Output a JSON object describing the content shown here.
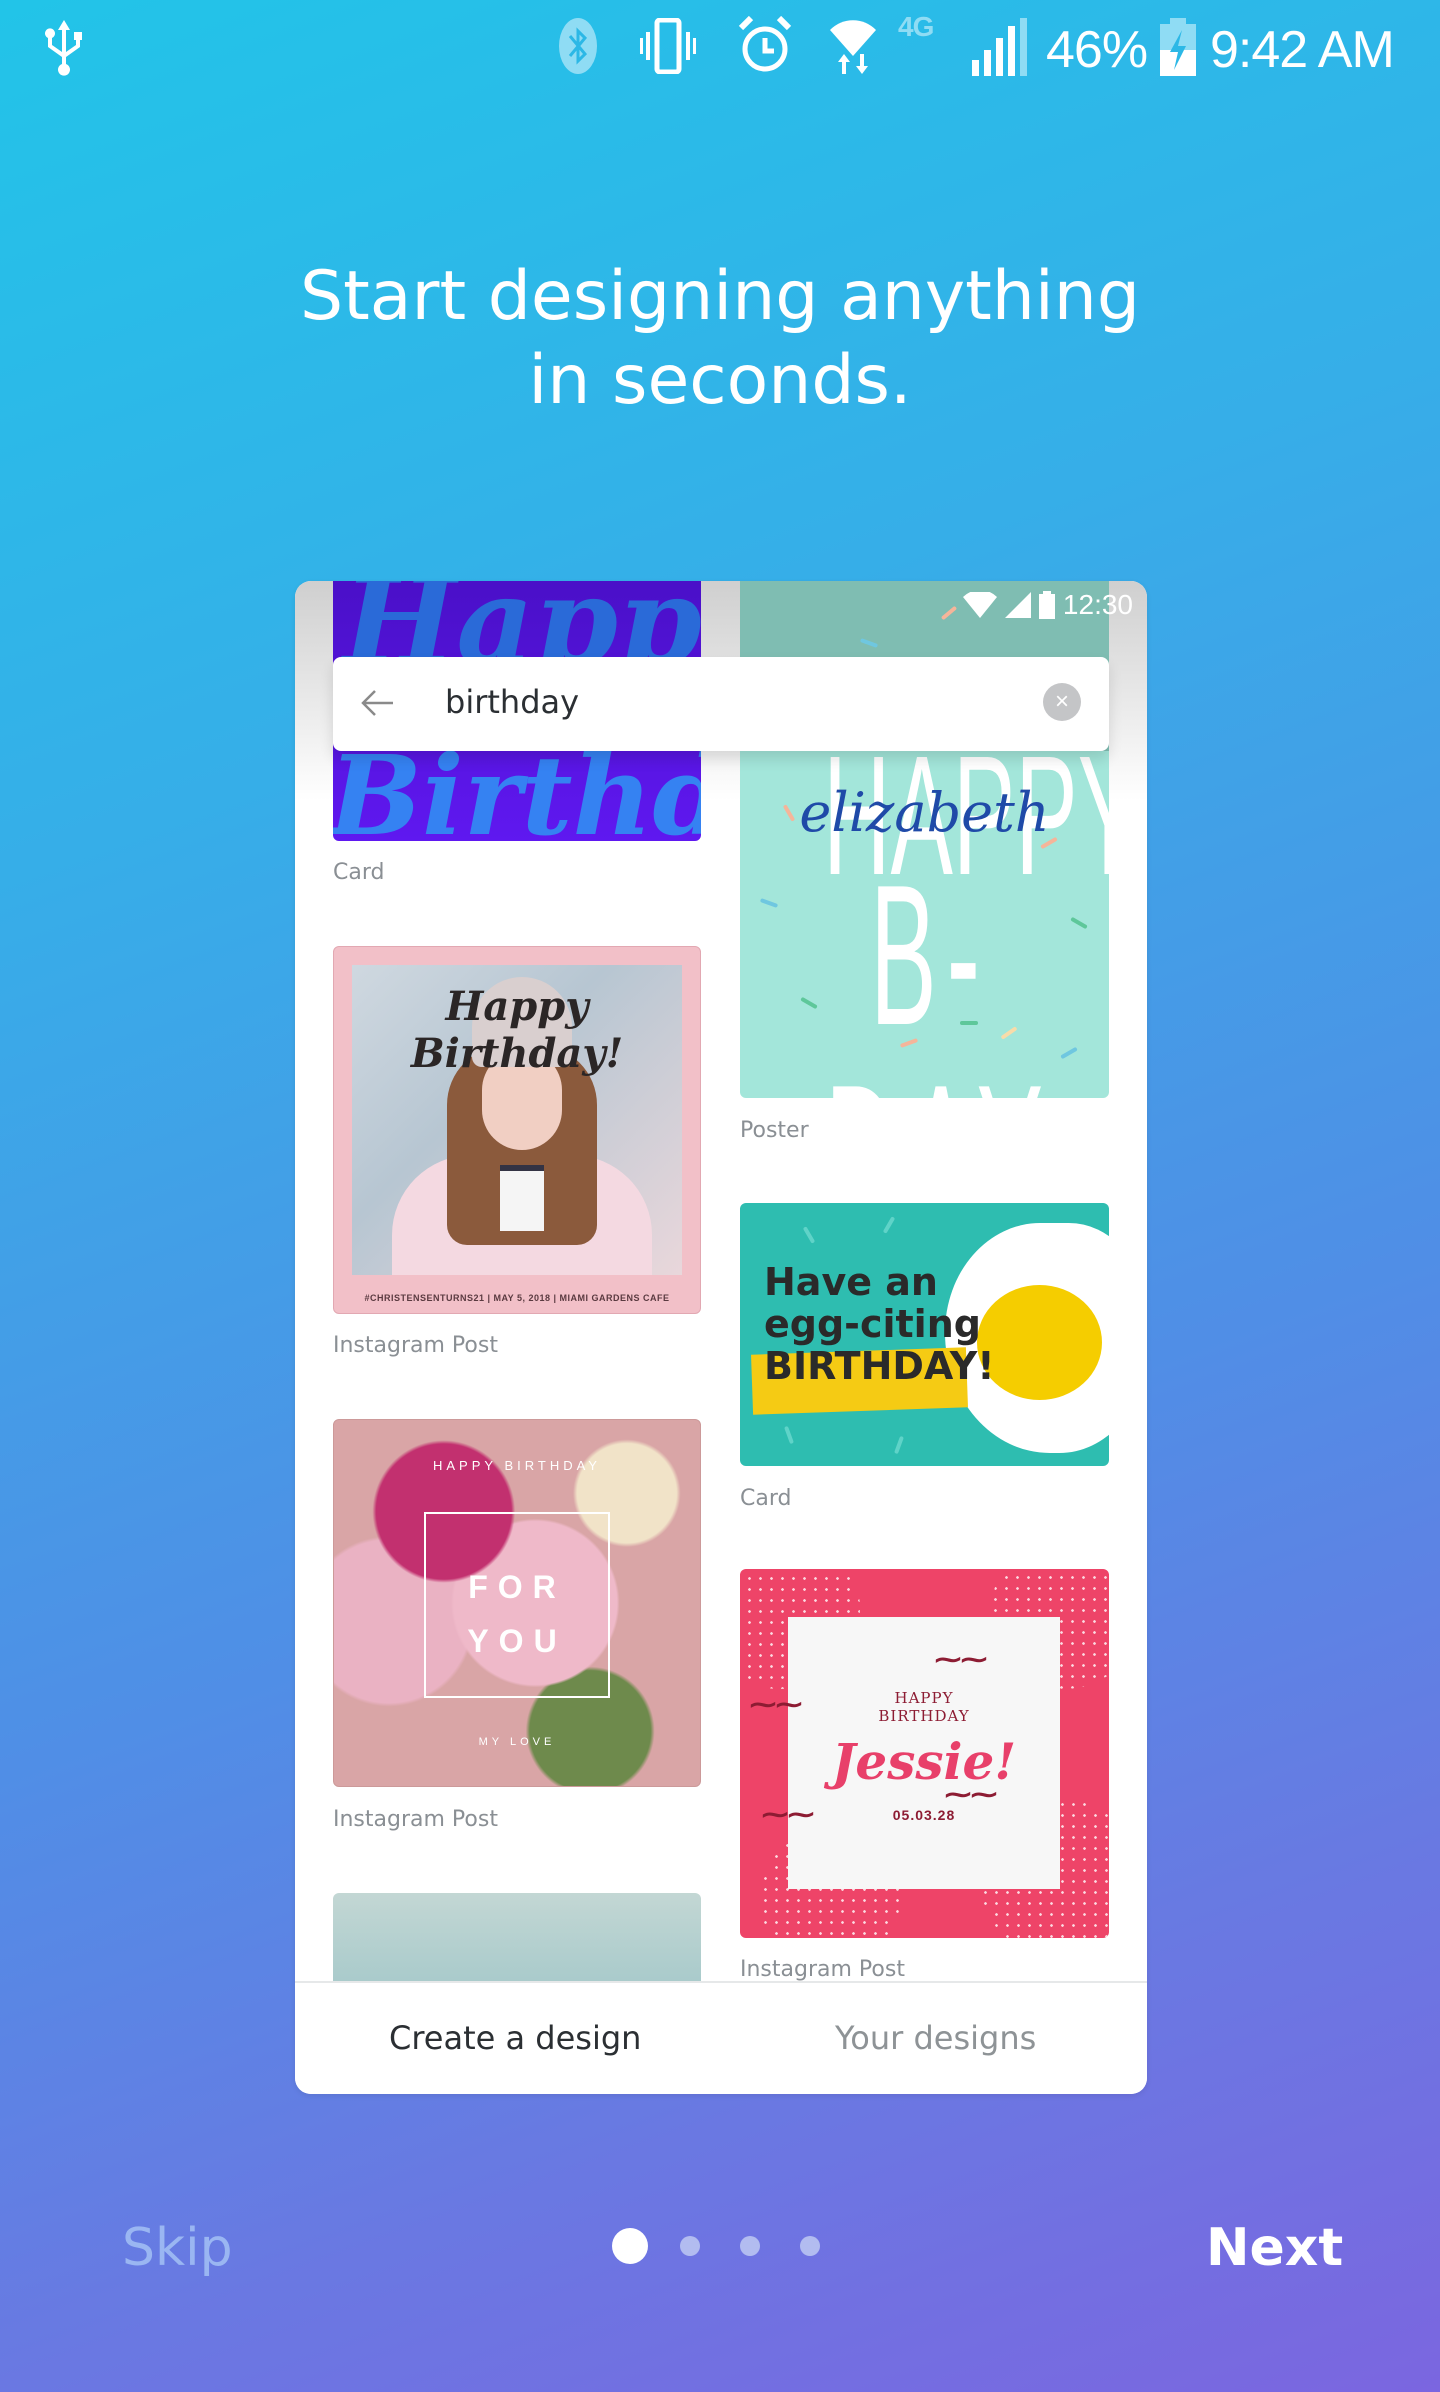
{
  "status_bar": {
    "left_icons": [
      "usb-icon"
    ],
    "right_icons": [
      "bluetooth-icon",
      "vibrate-icon",
      "alarm-icon",
      "wifi-icon",
      "lte-icon",
      "signal-icon",
      "battery-charging-icon"
    ],
    "lte_label": "4G",
    "battery_percent": "46%",
    "time": "9:42 AM"
  },
  "headline": {
    "line1": "Start designing anything",
    "line2": "in seconds."
  },
  "phone_preview": {
    "status_time": "12:30",
    "search": {
      "query": "birthday",
      "back_icon": "arrow-left-icon",
      "clear_icon": "close-circle-icon",
      "clear_glyph": "×"
    },
    "templates": [
      {
        "type": "Card",
        "title_line1": "Happy",
        "title_line2": "Birthday"
      },
      {
        "type": "Poster",
        "title_line1": "HAPPY",
        "name": "elizabeth",
        "title_line2": "B-DAY"
      },
      {
        "type": "Instagram Post",
        "title": "Happy Birthday!",
        "caption": "#CHRISTENSENTURNS21 | MAY 5, 2018 | MIAMI GARDENS CAFE"
      },
      {
        "type": "Card",
        "line1": "Have an",
        "line2": "egg-citing",
        "line3": "BIRTHDAY!"
      },
      {
        "type": "Instagram Post",
        "top": "HAPPY BIRTHDAY",
        "line1": "FOR",
        "line2": "YOU",
        "bottom": "MY LOVE"
      },
      {
        "type": "Instagram Post",
        "line1": "HAPPY",
        "line2": "BIRTHDAY",
        "name": "Jessie!",
        "date": "05.03.28"
      }
    ],
    "bottom_nav": [
      {
        "label": "Create a design",
        "active": true
      },
      {
        "label": "Your designs",
        "active": false
      }
    ]
  },
  "onboarding": {
    "skip_label": "Skip",
    "next_label": "Next",
    "page_indicator": {
      "current": 1,
      "total": 4
    }
  },
  "colors": {
    "gradient_start": "#22c4e8",
    "gradient_end": "#7b66e0",
    "nav_active": "#2b2f33",
    "nav_inactive": "#8e9396"
  }
}
